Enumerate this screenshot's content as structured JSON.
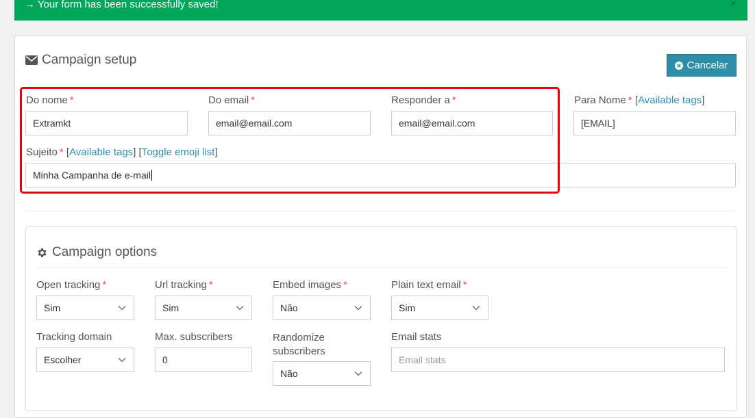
{
  "alert": {
    "message": "→ Your form has been successfully saved!",
    "close": "×"
  },
  "setup": {
    "title": "Campaign setup",
    "cancel_label": "Cancelar",
    "from_name": {
      "label": "Do nome",
      "req": "*",
      "value": "Extramkt"
    },
    "from_email": {
      "label": "Do email",
      "req": "*",
      "value": "email@email.com"
    },
    "reply_to": {
      "label": "Responder a",
      "req": "*",
      "value": "email@email.com"
    },
    "to_name": {
      "label": "Para Nome",
      "req": "*",
      "tags_link": "Available tags",
      "value": "[EMAIL]"
    },
    "subject": {
      "label": "Sujeito",
      "req": "*",
      "tags_link": "Available tags",
      "emoji_link": "Toggle emoji list",
      "value": "Minha Campanha de e-mail"
    }
  },
  "options": {
    "title": "Campaign options",
    "open_tracking": {
      "label": "Open tracking",
      "req": "*",
      "value": "Sim"
    },
    "url_tracking": {
      "label": "Url tracking",
      "req": "*",
      "value": "Sim"
    },
    "embed_images": {
      "label": "Embed images",
      "req": "*",
      "value": "Não"
    },
    "plain_text_email": {
      "label": "Plain text email",
      "req": "*",
      "value": "Sim"
    },
    "tracking_domain": {
      "label": "Tracking domain",
      "value": "Escolher"
    },
    "max_subscribers": {
      "label": "Max. subscribers",
      "value": "0"
    },
    "randomize_subscribers": {
      "label_line1": "Randomize",
      "label_line2": "subscribers",
      "value": "Não"
    },
    "email_stats": {
      "label": "Email stats",
      "placeholder": "Email stats"
    }
  },
  "colors": {
    "alert_bg": "#00a65a",
    "cancel_bg": "#2c8fa7",
    "required": "#d9534f",
    "link": "#2f8fb3",
    "highlight": "#e8000b"
  }
}
